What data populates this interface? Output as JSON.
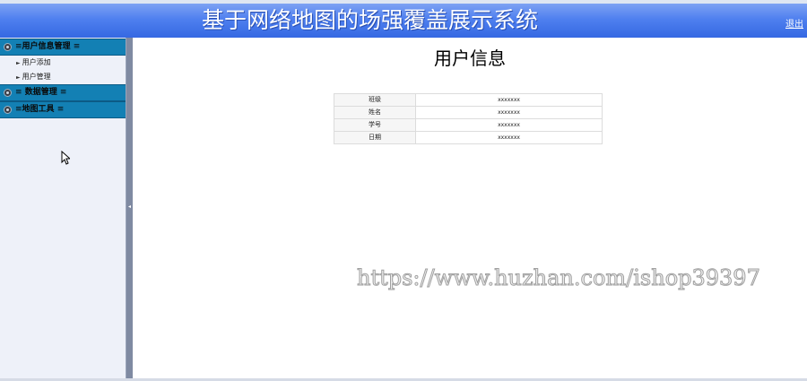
{
  "header": {
    "title": "基于网络地图的场强覆盖展示系统",
    "logout_label": "退出"
  },
  "sidebar": {
    "menus": [
      {
        "deco_left": "≡",
        "label": "用户信息管理",
        "deco_right": "≡",
        "icon": "gear-icon",
        "items": [
          {
            "label": "用户添加"
          },
          {
            "label": "用户管理"
          }
        ]
      },
      {
        "deco_left": "≡",
        "label": "数据管理",
        "deco_right": "≡",
        "icon": "gear-icon",
        "items": []
      },
      {
        "deco_left": "≡",
        "label": "地图工具",
        "deco_right": "≡",
        "icon": "gear-icon",
        "items": []
      }
    ],
    "collapse_handle": "◂"
  },
  "main": {
    "title": "用户信息",
    "rows": [
      {
        "key": "班级",
        "value": "xxxxxxx"
      },
      {
        "key": "姓名",
        "value": "xxxxxxx"
      },
      {
        "key": "学号",
        "value": "xxxxxxx"
      },
      {
        "key": "日期",
        "value": "xxxxxxx"
      }
    ]
  },
  "watermark": "https://www.huzhan.com/ishop39397",
  "colors": {
    "header": "#4f80ef",
    "menu_header": "#1380b4",
    "sidebar_bg": "#eef1f9",
    "divider": "#7f8aa2"
  }
}
